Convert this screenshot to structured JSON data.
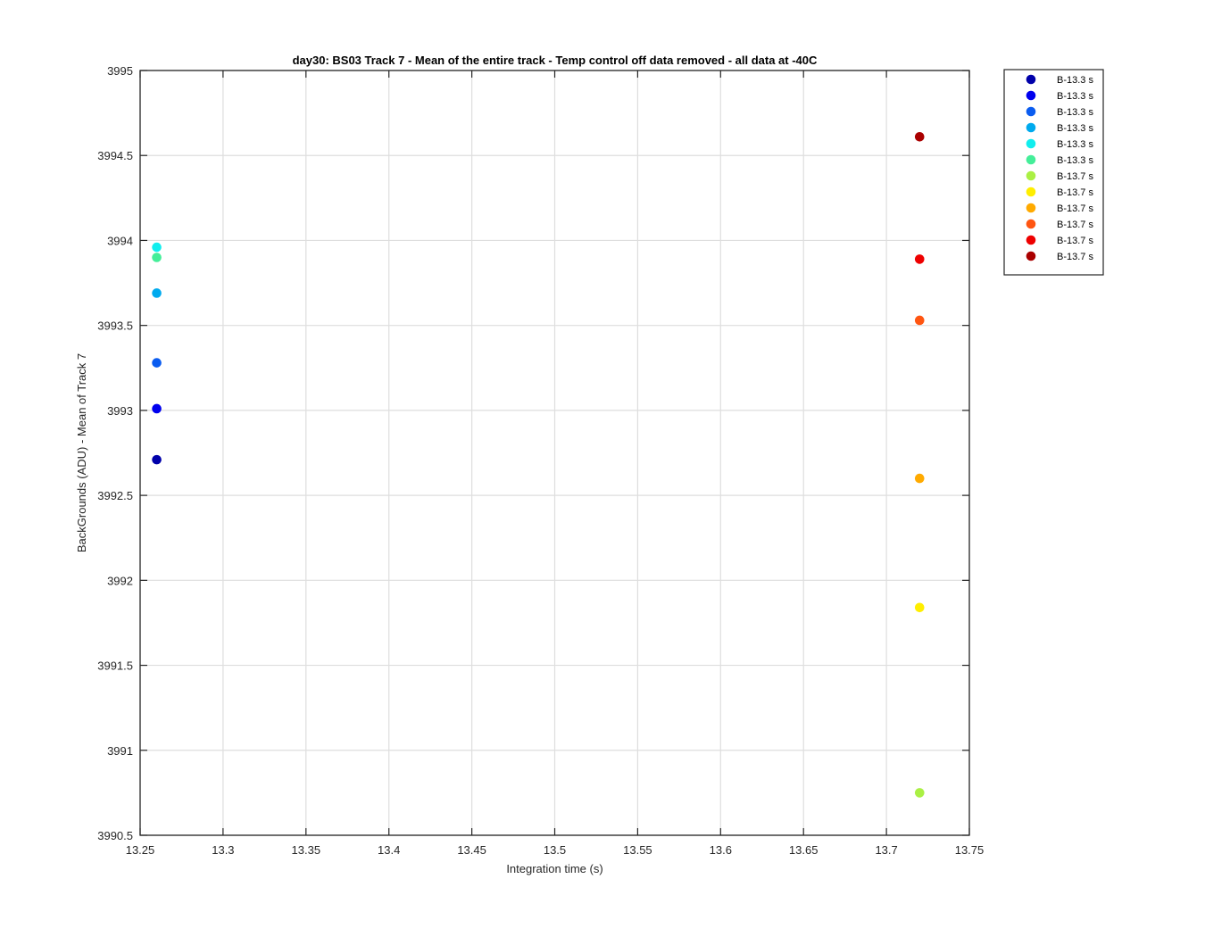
{
  "chart_data": {
    "type": "scatter",
    "title": "day30: BS03  Track 7 - Mean of the entire track - Temp control off data removed - all data at -40C",
    "xlabel": "Integration time (s)",
    "ylabel": "BackGrounds (ADU) - Mean of Track 7",
    "xlim": [
      13.25,
      13.75
    ],
    "ylim": [
      3990.5,
      3995
    ],
    "xticks": [
      13.25,
      13.3,
      13.35,
      13.4,
      13.45,
      13.5,
      13.55,
      13.6,
      13.65,
      13.7,
      13.75
    ],
    "xtick_labels": [
      "13.25",
      "13.3",
      "13.35",
      "13.4",
      "13.45",
      "13.5",
      "13.55",
      "13.6",
      "13.65",
      "13.7",
      "13.75"
    ],
    "yticks": [
      3990.5,
      3991,
      3991.5,
      3992,
      3992.5,
      3993,
      3993.5,
      3994,
      3994.5,
      3995
    ],
    "ytick_labels": [
      "3990.5",
      "3991",
      "3991.5",
      "3992",
      "3992.5",
      "3993",
      "3993.5",
      "3994",
      "3994.5",
      "3995"
    ],
    "grid": true,
    "legend_position": "outside-top-right",
    "series": [
      {
        "name": "B-13.3 s",
        "color": "#0000aa",
        "x": 13.26,
        "y": 3992.71
      },
      {
        "name": "B-13.3 s",
        "color": "#0000ee",
        "x": 13.26,
        "y": 3993.01
      },
      {
        "name": "B-13.3 s",
        "color": "#0a5cf0",
        "x": 13.26,
        "y": 3993.28
      },
      {
        "name": "B-13.3 s",
        "color": "#00aaee",
        "x": 13.26,
        "y": 3993.69
      },
      {
        "name": "B-13.3 s",
        "color": "#11eeee",
        "x": 13.26,
        "y": 3993.96
      },
      {
        "name": "B-13.3 s",
        "color": "#44ee99",
        "x": 13.26,
        "y": 3993.9
      },
      {
        "name": "B-13.7 s",
        "color": "#aaf044",
        "x": 13.72,
        "y": 3990.75
      },
      {
        "name": "B-13.7 s",
        "color": "#ffee00",
        "x": 13.72,
        "y": 3991.84
      },
      {
        "name": "B-13.7 s",
        "color": "#ffaa00",
        "x": 13.72,
        "y": 3992.6
      },
      {
        "name": "B-13.7 s",
        "color": "#ff5511",
        "x": 13.72,
        "y": 3993.53
      },
      {
        "name": "B-13.7 s",
        "color": "#ee0000",
        "x": 13.72,
        "y": 3993.89
      },
      {
        "name": "B-13.7 s",
        "color": "#aa0000",
        "x": 13.72,
        "y": 3994.61
      }
    ]
  }
}
